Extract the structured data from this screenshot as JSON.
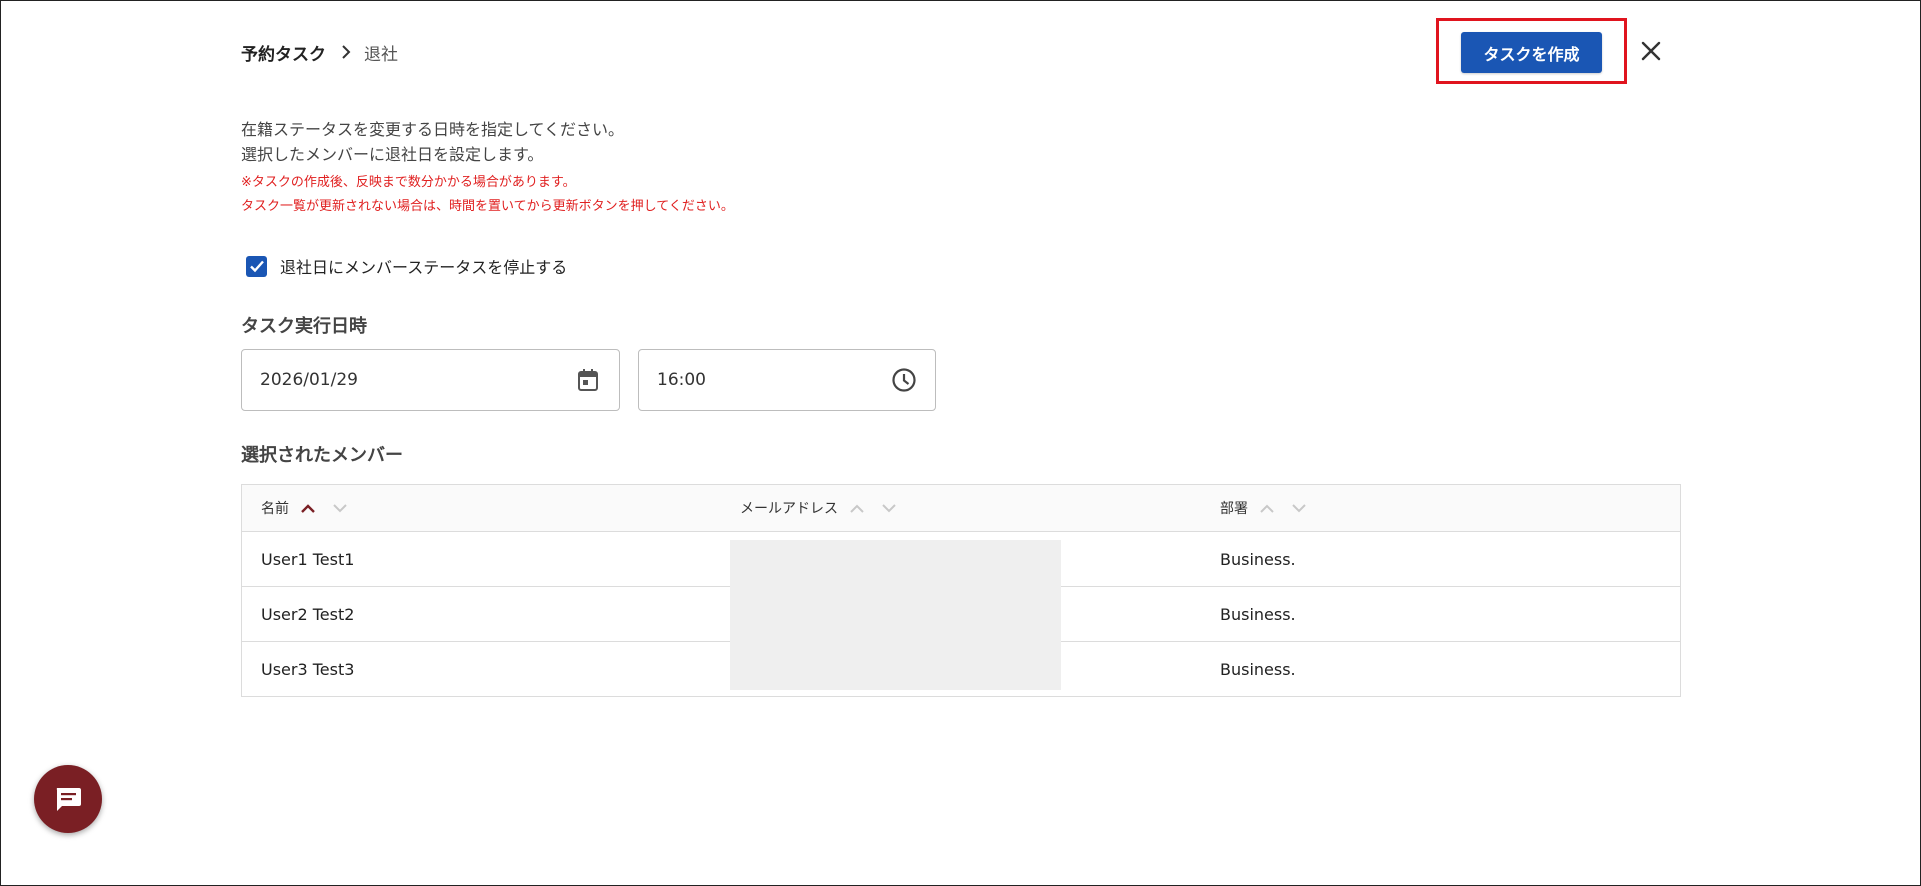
{
  "header": {
    "breadcrumb_parent": "予約タスク",
    "breadcrumb_current": "退社",
    "create_button": "タスクを作成",
    "close_icon": "close-icon"
  },
  "description": {
    "line1": "在籍ステータスを変更する日時を指定してください。",
    "line2": "選択したメンバーに退社日を設定します。",
    "note1": "※タスクの作成後、反映まで数分かかる場合があります。",
    "note2": "タスク一覧が更新されない場合は、時間を置いてから更新ボタンを押してください。",
    "note_color": "#e02020"
  },
  "options": {
    "suspend_checkbox_label": "退社日にメンバーステータスを停止する",
    "suspend_checked": true
  },
  "schedule": {
    "title": "タスク実行日時",
    "date_value": "2026/01/29",
    "time_value": "16:00",
    "date_icon": "calendar-icon",
    "time_icon": "clock-icon"
  },
  "members": {
    "title": "選択されたメンバー",
    "columns": [
      "名前",
      "メールアドレス",
      "部署"
    ],
    "sort_active": {
      "column": "名前",
      "direction": "asc"
    },
    "rows": [
      {
        "name": "User1 Test1",
        "email": "",
        "department": "Business."
      },
      {
        "name": "User2 Test2",
        "email": "",
        "department": "Business."
      },
      {
        "name": "User3 Test3",
        "email": "",
        "department": "Business."
      }
    ]
  },
  "chat": {
    "icon": "chat-icon"
  },
  "colors": {
    "primary": "#1a56b4",
    "highlight_border": "#e0141e",
    "chat_button": "#7a1f24",
    "sort_active": "#7a1f24"
  }
}
